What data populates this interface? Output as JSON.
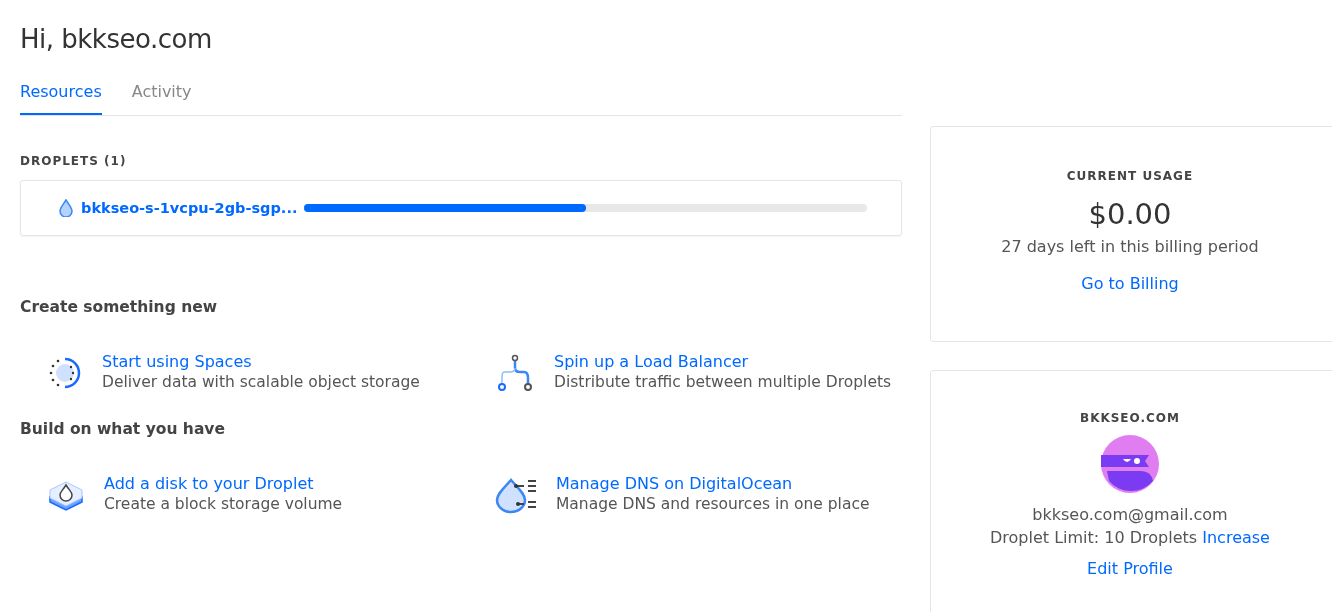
{
  "greeting": "Hi, bkkseo.com",
  "tabs": [
    {
      "label": "Resources",
      "selected": true
    },
    {
      "label": "Activity",
      "selected": false
    }
  ],
  "droplets": {
    "heading": "DROPLETS (1)",
    "items": [
      {
        "name": "bkkseo-s-1vcpu-2gb-sgp...",
        "level": 0.5
      }
    ]
  },
  "sections": [
    {
      "heading": "Create something new",
      "items": [
        {
          "kind": "spaces",
          "title": "Start using Spaces",
          "description": "Deliver data with scalable object storage"
        },
        {
          "kind": "balancer",
          "title": "Spin up a Load Balancer",
          "description": "Distribute traffic between multiple Droplets"
        }
      ]
    },
    {
      "heading": "Build on what you have",
      "items": [
        {
          "kind": "volume",
          "title": "Add a disk to your Droplet",
          "description": "Create a block storage volume"
        },
        {
          "kind": "dns",
          "title": "Manage DNS on DigitalOcean",
          "description": "Manage DNS and resources in one place"
        }
      ]
    }
  ],
  "usage": {
    "heading": "CURRENT USAGE",
    "amount": "$0.00",
    "period": "27 days left in this billing period",
    "link": "Go to Billing"
  },
  "profile": {
    "heading": "BKKSEO.COM",
    "email": "bkkseo.com@gmail.com",
    "limit": "Droplet Limit: 10 Droplets",
    "limit_link": "Increase",
    "link": "Edit Profile"
  }
}
